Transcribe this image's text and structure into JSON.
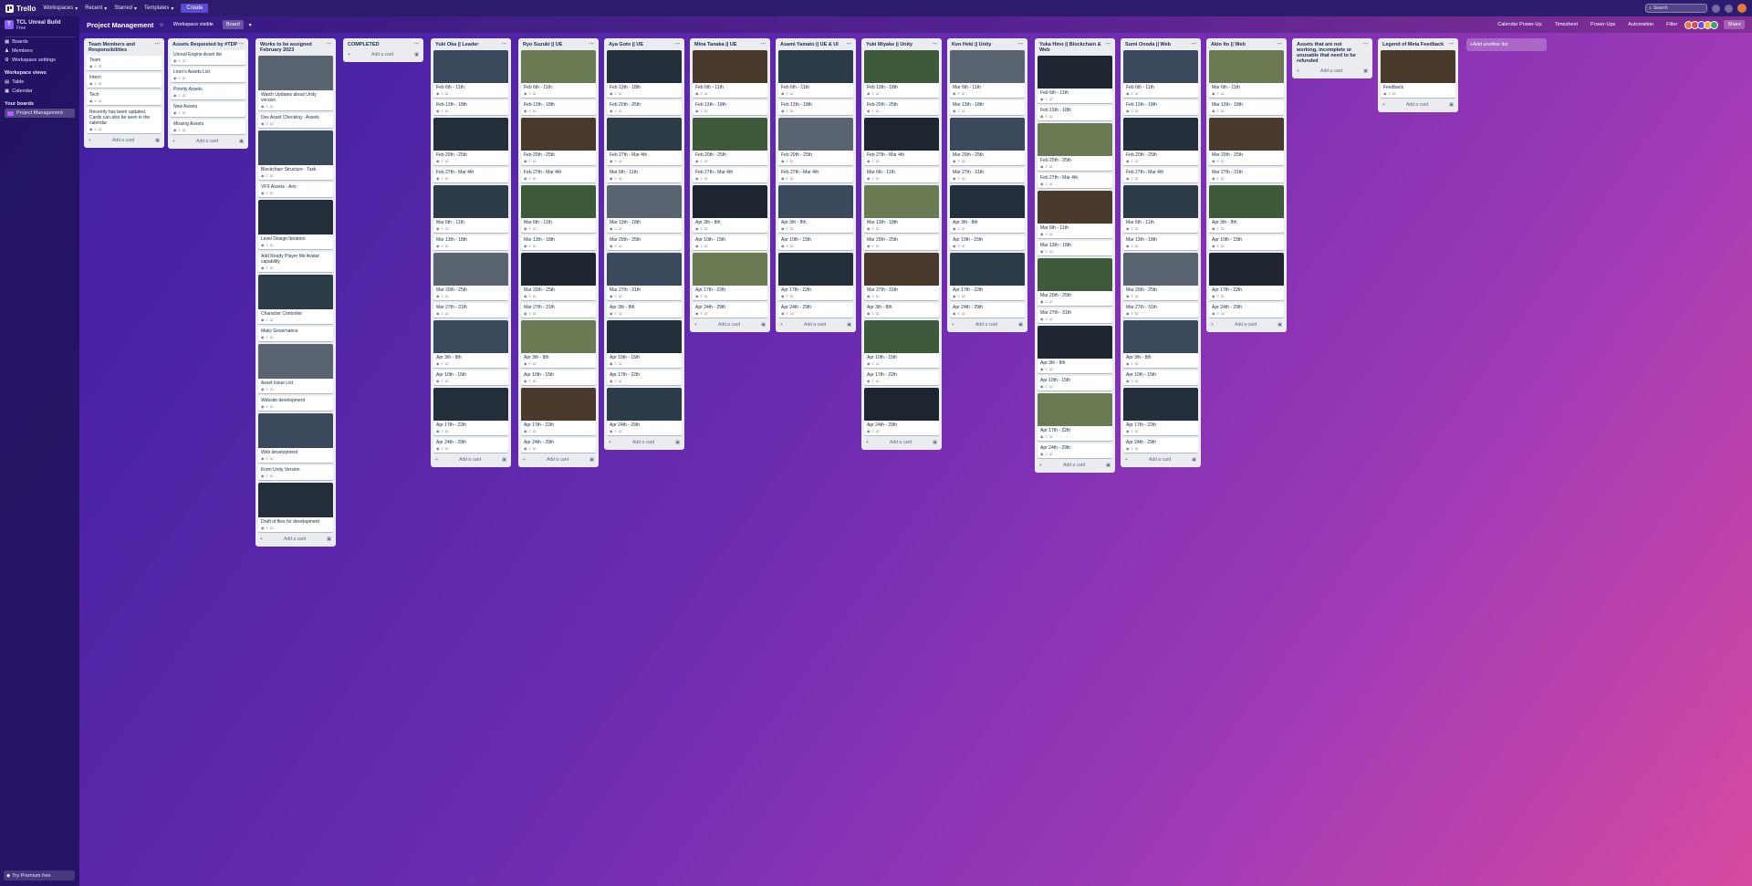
{
  "app": {
    "name": "Trello"
  },
  "topnav": {
    "items": [
      "Workspaces",
      "Recent",
      "Starred",
      "Templates"
    ],
    "create_label": "Create",
    "search_placeholder": "Search"
  },
  "sidebar": {
    "workspace_name": "TCL Unreal Build",
    "workspace_plan": "Free",
    "links": [
      "Boards",
      "Members",
      "Workspace settings"
    ],
    "views_title": "Workspace views",
    "views": [
      "Table",
      "Calendar"
    ],
    "boards_title": "Your boards",
    "boards": [
      "Project Management"
    ],
    "premium_label": "Try Premium free"
  },
  "board_header": {
    "title": "Project Management",
    "visibility": "Workspace visible",
    "view_label": "Board",
    "right_items": [
      "Calendar Power-Up",
      "Timesheet",
      "Power-Ups",
      "Automation",
      "Filter"
    ],
    "share_label": "Share"
  },
  "lists": [
    {
      "title": "Team Members and Responsibilities",
      "cards": [
        "Team",
        "Intern",
        "Tech",
        "Recently has been updated, Cards can also be seen in the calendar"
      ]
    },
    {
      "title": "Assets Requested by #TDP",
      "cards": [
        "Unreal Engine Asset list",
        "Leon's Assets List",
        "Priority Assets",
        "New Assets",
        "Missing Assets"
      ]
    },
    {
      "title": "Works to be assigned February 2023",
      "cards": [
        "Watch Updates about Unity version",
        "Dev Asset Checking - Assets",
        "Blockchain Structure - Task",
        "VFX Assets - Aris",
        "Level Design Iteration",
        "Add Ready Player Me Avatar capability",
        "Character Controller",
        "Matic Governance",
        "Asset Issue List",
        "Website development",
        "Web development",
        "From Unity Version",
        "Draft of files for development"
      ]
    },
    {
      "title": "COMPLETED",
      "cards": []
    },
    {
      "title": "Yuki Oka || Leader",
      "cards": [
        "Feb 6th - 11th",
        "Feb 13th - 18th",
        "Feb 20th - 25th",
        "Feb 27th - Mar 4th",
        "Mar 6th - 11th",
        "Mar 13th - 18th",
        "Mar 20th - 25th",
        "Mar 27th - 31th",
        "Apr 3th - 8th",
        "Apr 10th - 15th",
        "Apr 17th - 22th",
        "Apr 24th - 29th"
      ]
    },
    {
      "title": "Ryo Suzuki || UE",
      "cards": [
        "Feb 6th - 11th",
        "Feb 13th - 18th",
        "Feb 20th - 25th",
        "Feb 27th - Mar 4th",
        "Mar 6th - 11th",
        "Mar 13th - 18th",
        "Mar 20th - 25th",
        "Mar 27th - 31th",
        "Apr 3th - 8th",
        "Apr 10th - 15th",
        "Apr 17th - 22th",
        "Apr 24th - 29th"
      ]
    },
    {
      "title": "Aya Goto || UE",
      "cards": [
        "Feb 13th - 18th",
        "Feb 20th - 25th",
        "Feb 27th - Mar 4th",
        "Mar 6th - 11th",
        "Mar 13th - 18th",
        "Mar 20th - 25th",
        "Mar 27th - 31th",
        "Apr 3th - 8th",
        "Apr 10th - 15th",
        "Apr 17th - 22th",
        "Apr 24th - 29th"
      ]
    },
    {
      "title": "Mina Tanaka || UE",
      "cards": [
        "Feb 6th - 11th",
        "Feb 13th - 18th",
        "Feb 20th - 25th",
        "Feb 27th - Mar 4th",
        "Apr 3th - 8th",
        "Apr 10th - 15th",
        "Apr 17th - 22th",
        "Apr 24th - 29th"
      ]
    },
    {
      "title": "Asami Yamato || UE & UI",
      "cards": [
        "Feb 6th - 11th",
        "Feb 13th - 18th",
        "Feb 20th - 25th",
        "Feb 27th - Mar 4th",
        "Apr 3th - 8th",
        "Apr 10th - 15th",
        "Apr 17th - 22th",
        "Apr 24th - 29th"
      ]
    },
    {
      "title": "Yuki Miyake || Unity",
      "cards": [
        "Feb 13th - 18th",
        "Feb 20th - 25th",
        "Feb 27th - Mar 4th",
        "Mar 6th - 11th",
        "Mar 13th - 18th",
        "Mar 20th - 25th",
        "Mar 27th - 31th",
        "Apr 3th - 8th",
        "Apr 10th - 15th",
        "Apr 17th - 22th",
        "Apr 24th - 29th"
      ]
    },
    {
      "title": "Ken Heki || Unity",
      "cards": [
        "Mar 6th - 11th",
        "Mar 13th - 18th",
        "Mar 20th - 25th",
        "Mar 27th - 31th",
        "Apr 3th - 8th",
        "Apr 10th - 15th",
        "Apr 17th - 22th",
        "Apr 24th - 29th"
      ]
    },
    {
      "title": "Yuka Hino || Blockchain & Web",
      "cards": [
        "Feb 6th - 11th",
        "Feb 13th - 18th",
        "Feb 20th - 25th",
        "Feb 27th - Mar 4th",
        "Mar 6th - 11th",
        "Mar 13th - 18th",
        "Mar 20th - 25th",
        "Mar 27th - 31th",
        "Apr 3th - 8th",
        "Apr 10th - 15th",
        "Apr 17th - 22th",
        "Apr 24th - 29th"
      ]
    },
    {
      "title": "Sumi Onoda || Web",
      "cards": [
        "Feb 6th - 11th",
        "Feb 13th - 18th",
        "Feb 20th - 25th",
        "Feb 27th - Mar 4th",
        "Mar 6th - 11th",
        "Mar 13th - 18th",
        "Mar 20th - 25th",
        "Mar 27th - 31th",
        "Apr 3th - 8th",
        "Apr 10th - 15th",
        "Apr 17th - 22th",
        "Apr 24th - 29th"
      ]
    },
    {
      "title": "Akio Ito || Web",
      "cards": [
        "Mar 6th - 11th",
        "Mar 13th - 18th",
        "Mar 20th - 25th",
        "Mar 27th - 31th",
        "Apr 3th - 8th",
        "Apr 10th - 15th",
        "Apr 17th - 22th",
        "Apr 24th - 29th"
      ]
    },
    {
      "title": "Assets that are not working, incomplete or unusable that need to be refunded",
      "cards": []
    },
    {
      "title": "Legend of Meta Feedback",
      "cards": [
        "Feedback"
      ]
    }
  ],
  "add_card_label": "Add a card",
  "add_list_label": "Add another list"
}
